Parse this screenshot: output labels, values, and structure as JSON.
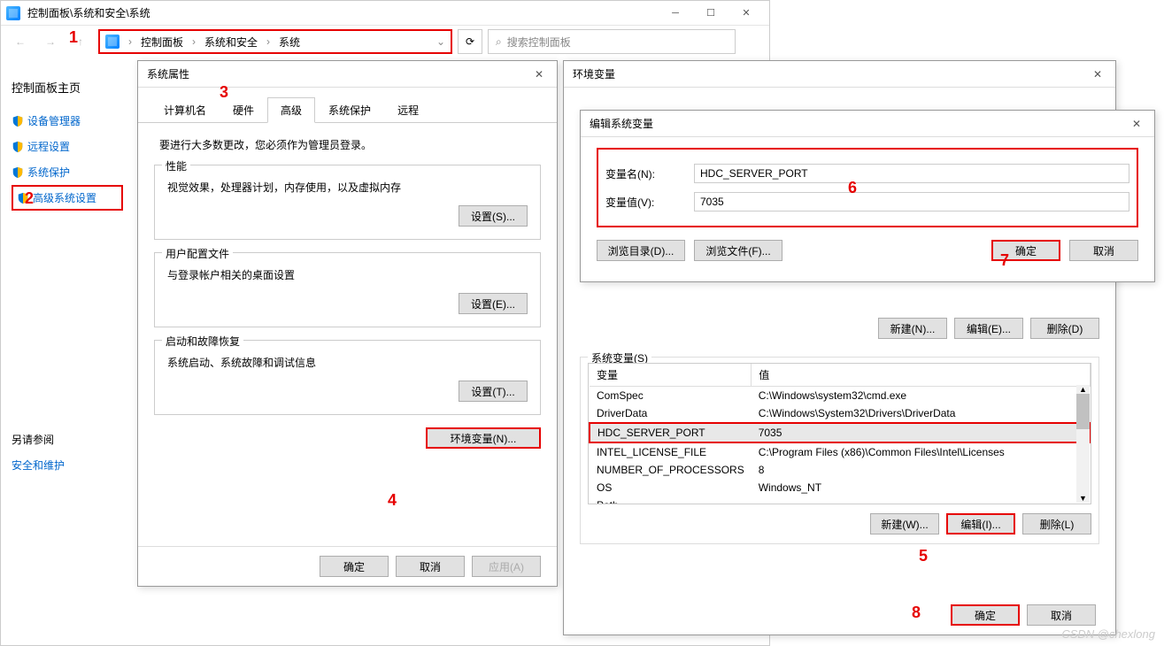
{
  "controlPanel": {
    "windowTitle": "控制面板\\系统和安全\\系统",
    "breadcrumb": [
      "控制面板",
      "系统和安全",
      "系统"
    ],
    "searchPlaceholder": "搜索控制面板",
    "sidebar": {
      "home": "控制面板主页",
      "links": [
        "设备管理器",
        "远程设置",
        "系统保护",
        "高级系统设置"
      ],
      "alsoSee": "另请参阅",
      "alsoLinks": [
        "安全和维护"
      ]
    }
  },
  "sysProps": {
    "title": "系统属性",
    "tabs": [
      "计算机名",
      "硬件",
      "高级",
      "系统保护",
      "远程"
    ],
    "intro": "要进行大多数更改，您必须作为管理员登录。",
    "perf": {
      "title": "性能",
      "desc": "视觉效果，处理器计划，内存使用，以及虚拟内存",
      "btn": "设置(S)..."
    },
    "profile": {
      "title": "用户配置文件",
      "desc": "与登录帐户相关的桌面设置",
      "btn": "设置(E)..."
    },
    "startup": {
      "title": "启动和故障恢复",
      "desc": "系统启动、系统故障和调试信息",
      "btn": "设置(T)..."
    },
    "envBtn": "环境变量(N)...",
    "ok": "确定",
    "cancel": "取消",
    "apply": "应用(A)"
  },
  "envVar": {
    "title": "环境变量",
    "sysVarsTitle": "系统变量(S)",
    "columns": [
      "变量",
      "值"
    ],
    "userBtns": {
      "new": "新建(N)...",
      "edit": "编辑(E)...",
      "del": "删除(D)"
    },
    "sysBtns": {
      "new": "新建(W)...",
      "edit": "编辑(I)...",
      "del": "删除(L)"
    },
    "sysVars": [
      {
        "name": "ComSpec",
        "value": "C:\\Windows\\system32\\cmd.exe"
      },
      {
        "name": "DriverData",
        "value": "C:\\Windows\\System32\\Drivers\\DriverData"
      },
      {
        "name": "HDC_SERVER_PORT",
        "value": "7035"
      },
      {
        "name": "INTEL_LICENSE_FILE",
        "value": "C:\\Program Files (x86)\\Common Files\\Intel\\Licenses"
      },
      {
        "name": "NUMBER_OF_PROCESSORS",
        "value": "8"
      },
      {
        "name": "OS",
        "value": "Windows_NT"
      },
      {
        "name": "Path",
        "value": ""
      }
    ],
    "ok": "确定",
    "cancel": "取消"
  },
  "editEnv": {
    "title": "编辑系统变量",
    "nameLabel": "变量名(N):",
    "valueLabel": "变量值(V):",
    "name": "HDC_SERVER_PORT",
    "value": "7035",
    "browseDir": "浏览目录(D)...",
    "browseFile": "浏览文件(F)...",
    "ok": "确定",
    "cancel": "取消"
  },
  "annotations": {
    "1": "1",
    "2": "2",
    "3": "3",
    "4": "4",
    "5": "5",
    "6": "6",
    "7": "7",
    "8": "8"
  },
  "watermark": "CSDN @chexlong"
}
